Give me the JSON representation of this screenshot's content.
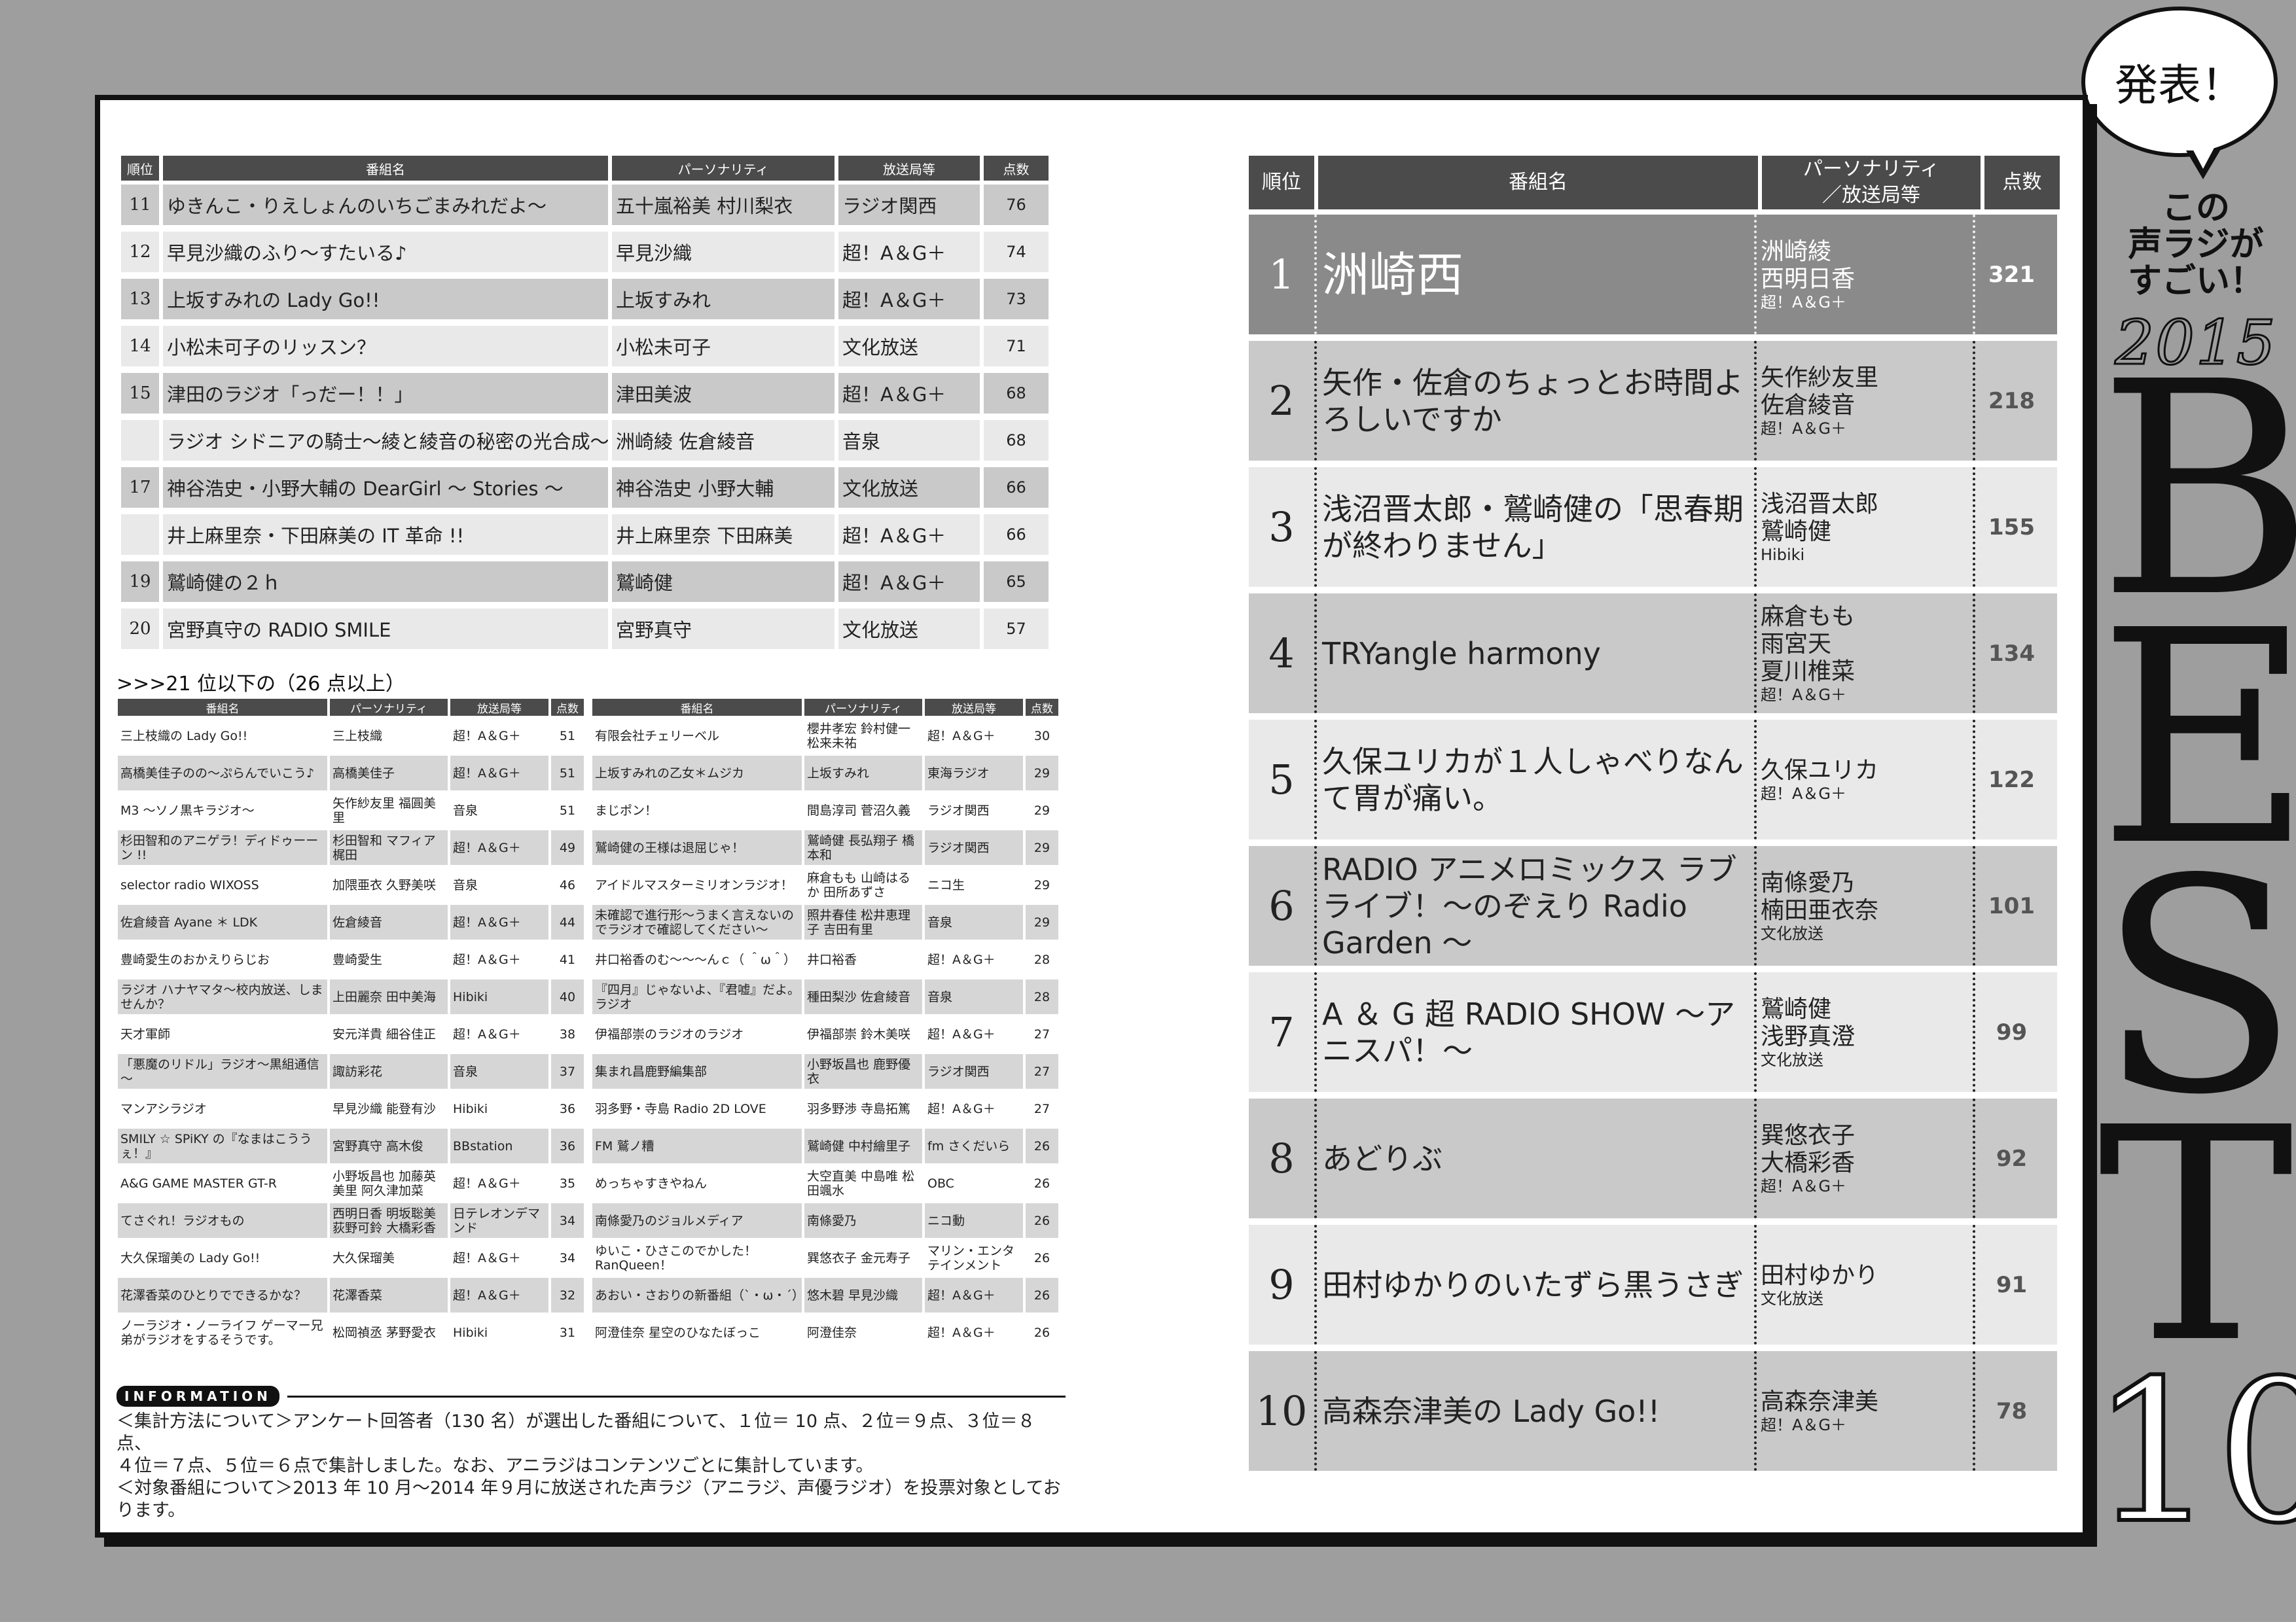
{
  "badge": {
    "text": "発表！"
  },
  "side": {
    "title_lines": [
      "この",
      "声ラジが",
      "すごい！"
    ],
    "year": "2015",
    "word_letters": [
      "B",
      "E",
      "S",
      "T"
    ],
    "number": "10"
  },
  "table_11_20": {
    "headers": {
      "rank": "順位",
      "name": "番組名",
      "personality": "パーソナリティ",
      "station": "放送局等",
      "points": "点数"
    },
    "rows": [
      {
        "rank": "11",
        "name": "ゆきんこ・りえしょんのいちごまみれだよ～",
        "personality": "五十嵐裕美 村川梨衣",
        "station": "ラジオ関西",
        "points": "76"
      },
      {
        "rank": "12",
        "name": "早見沙織のふり～すたいる♪",
        "personality": "早見沙織",
        "station": "超！A＆G＋",
        "points": "74"
      },
      {
        "rank": "13",
        "name": "上坂すみれの Lady Go!!",
        "personality": "上坂すみれ",
        "station": "超！A＆G＋",
        "points": "73"
      },
      {
        "rank": "14",
        "name": "小松未可子のリッスン？",
        "personality": "小松未可子",
        "station": "文化放送",
        "points": "71"
      },
      {
        "rank": "15",
        "name": "津田のラジオ「っだー！！」",
        "personality": "津田美波",
        "station": "超！A＆G＋",
        "points": "68"
      },
      {
        "rank": "",
        "name": "ラジオ シドニアの騎士～綾と綾音の秘密の光合成～",
        "personality": "洲崎綾 佐倉綾音",
        "station": "音泉",
        "points": "68"
      },
      {
        "rank": "17",
        "name": "神谷浩史・小野大輔の DearGirl ～ Stories ～",
        "personality": "神谷浩史 小野大輔",
        "station": "文化放送",
        "points": "66"
      },
      {
        "rank": "",
        "name": "井上麻里奈・下田麻美の IT 革命 !!",
        "personality": "井上麻里奈 下田麻美",
        "station": "超！A＆G＋",
        "points": "66"
      },
      {
        "rank": "19",
        "name": "鷲崎健の２ｈ",
        "personality": "鷲崎健",
        "station": "超！A＆G＋",
        "points": "65"
      },
      {
        "rank": "20",
        "name": "宮野真守の RADIO SMILE",
        "personality": "宮野真守",
        "station": "文化放送",
        "points": "57"
      }
    ]
  },
  "sub_heading": ">>>21 位以下の（26 点以上）",
  "small_headers": {
    "name": "番組名",
    "personality": "パーソナリティ",
    "station": "放送局等",
    "points": "点数"
  },
  "small_left": [
    {
      "name": "三上枝織の Lady Go!!",
      "personality": "三上枝織",
      "station": "超！A＆G＋",
      "points": "51"
    },
    {
      "name": "高橋美佳子のの～ぷらんでいこう♪",
      "personality": "高橋美佳子",
      "station": "超！A＆G＋",
      "points": "51"
    },
    {
      "name": "M3 ～ソノ黒キラジオ～",
      "personality": "矢作紗友里 福圓美里",
      "station": "音泉",
      "points": "51"
    },
    {
      "name": "杉田智和のアニゲラ！ディドゥーーン !!",
      "personality": "杉田智和 マフィア梶田",
      "station": "超！A＆G＋",
      "points": "49"
    },
    {
      "name": "selector radio WIXOSS",
      "personality": "加隈亜衣 久野美咲",
      "station": "音泉",
      "points": "46"
    },
    {
      "name": "佐倉綾音 Ayane ＊ LDK",
      "personality": "佐倉綾音",
      "station": "超！A＆G＋",
      "points": "44"
    },
    {
      "name": "豊崎愛生のおかえりらじお",
      "personality": "豊崎愛生",
      "station": "超！A＆G＋",
      "points": "41"
    },
    {
      "name": "ラジオ ハナヤマタ～校内放送、しませんか？",
      "personality": "上田麗奈 田中美海",
      "station": "Hibiki",
      "points": "40"
    },
    {
      "name": "天才軍師",
      "personality": "安元洋貴 細谷佳正",
      "station": "超！A＆G＋",
      "points": "38"
    },
    {
      "name": "「悪魔のリドル」ラジオ～黒組通信～",
      "personality": "諏訪彩花",
      "station": "音泉",
      "points": "37"
    },
    {
      "name": "マンアシラジオ",
      "personality": "早見沙織 能登有沙",
      "station": "Hibiki",
      "points": "36"
    },
    {
      "name": "SMILY ☆ SPiKY の『なまはこううぇ！』",
      "personality": "宮野真守 高木俊",
      "station": "BBstation",
      "points": "36"
    },
    {
      "name": "A&G GAME MASTER GT-R",
      "personality": "小野坂昌也 加藤英美里 阿久津加菜",
      "station": "超！A＆G＋",
      "points": "35"
    },
    {
      "name": "てさぐれ！ラジオもの",
      "personality": "西明日香 明坂聡美 荻野可鈴 大橋彩香",
      "station": "日テレオンデマンド",
      "points": "34"
    },
    {
      "name": "大久保瑠美の Lady Go!!",
      "personality": "大久保瑠美",
      "station": "超！A＆G＋",
      "points": "34"
    },
    {
      "name": "花澤香菜のひとりでできるかな？",
      "personality": "花澤香菜",
      "station": "超！A＆G＋",
      "points": "32"
    },
    {
      "name": "ノーラジオ・ノーライフ ゲーマー兄弟がラジオをするそうです。",
      "personality": "松岡禎丞 茅野愛衣",
      "station": "Hibiki",
      "points": "31"
    }
  ],
  "small_right": [
    {
      "name": "有限会社チェリーベル",
      "personality": "櫻井孝宏 鈴村健一 松来未祐",
      "station": "超！A＆G＋",
      "points": "30"
    },
    {
      "name": "上坂すみれの乙女＊ムジカ",
      "personality": "上坂すみれ",
      "station": "東海ラジオ",
      "points": "29"
    },
    {
      "name": "まじポン！",
      "personality": "間島淳司 菅沼久義",
      "station": "ラジオ関西",
      "points": "29"
    },
    {
      "name": "鷲崎健の王様は退屈じゃ！",
      "personality": "鷲崎健 長弘翔子 橋本和",
      "station": "ラジオ関西",
      "points": "29"
    },
    {
      "name": "アイドルマスターミリオンラジオ！",
      "personality": "麻倉もも 山崎はるか 田所あずさ",
      "station": "ニコ生",
      "points": "29"
    },
    {
      "name": "未確認で進行形～うまく言えないのでラジオで確認してください～",
      "personality": "照井春佳 松井恵理子 吉田有里",
      "station": "音泉",
      "points": "29"
    },
    {
      "name": "井口裕香のむ～～～んｃ（ ＾ω＾）",
      "personality": "井口裕香",
      "station": "超！A＆G＋",
      "points": "28"
    },
    {
      "name": "『四月』じゃないよ、『君嘘』だよ。ラジオ",
      "personality": "種田梨沙 佐倉綾音",
      "station": "音泉",
      "points": "28"
    },
    {
      "name": "伊福部崇のラジオのラジオ",
      "personality": "伊福部崇 鈴木美咲",
      "station": "超！A＆G＋",
      "points": "27"
    },
    {
      "name": "集まれ昌鹿野編集部",
      "personality": "小野坂昌也 鹿野優衣",
      "station": "ラジオ関西",
      "points": "27"
    },
    {
      "name": "羽多野・寺島 Radio 2D LOVE",
      "personality": "羽多野渉 寺島拓篤",
      "station": "超！A＆G＋",
      "points": "27"
    },
    {
      "name": "FM 鷲ノ糟",
      "personality": "鷲崎健 中村繪里子",
      "station": "fm さくだいら",
      "points": "26"
    },
    {
      "name": "めっちゃすきやねん",
      "personality": "大空直美 中島唯 松田颯水",
      "station": "OBC",
      "points": "26"
    },
    {
      "name": "南條愛乃のジョルメディア",
      "personality": "南條愛乃",
      "station": "ニコ動",
      "points": "26"
    },
    {
      "name": "ゆいこ・ひさこのでかした！RanQueen！",
      "personality": "巽悠衣子 金元寿子",
      "station": "マリン・エンタテインメント",
      "points": "26"
    },
    {
      "name": "あおい・さおりの新番組（`・ω・´）",
      "personality": "悠木碧 早見沙織",
      "station": "超！A＆G＋",
      "points": "26"
    },
    {
      "name": "阿澄佳奈 星空のひなたぼっこ",
      "personality": "阿澄佳奈",
      "station": "超！A＆G＋",
      "points": "26"
    }
  ],
  "information": {
    "badge": "INFORMATION",
    "lines": [
      "＜集計方法について＞アンケート回答者（130 名）が選出した番組について、１位＝ 10 点、２位＝９点、３位＝８点、",
      "４位＝７点、５位＝６点で集計しました。なお、アニラジはコンテンツごとに集計しています。",
      "＜対象番組について＞2013 年 10 月～2014 年９月に放送された声ラジ（アニラジ、声優ラジオ）を投票対象としております。"
    ]
  },
  "best10": {
    "headers": {
      "rank": "順位",
      "name": "番組名",
      "personality_line1": "パーソナリティ",
      "personality_line2": "／放送局等",
      "points": "点数"
    },
    "rows": [
      {
        "rank": "1",
        "name": "洲崎西",
        "personalities": [
          "洲崎綾",
          "西明日香"
        ],
        "station": "超！A＆G＋",
        "points": "321"
      },
      {
        "rank": "2",
        "name": "矢作・佐倉のちょっとお時間よろしいですか",
        "personalities": [
          "矢作紗友里",
          "佐倉綾音"
        ],
        "station": "超！A＆G＋",
        "points": "218"
      },
      {
        "rank": "3",
        "name": "浅沼晋太郎・鷲崎健の「思春期が終わりません」",
        "personalities": [
          "浅沼晋太郎",
          "鷲崎健"
        ],
        "station": "Hibiki",
        "points": "155"
      },
      {
        "rank": "4",
        "name": "TRYangle harmony",
        "personalities": [
          "麻倉もも",
          "雨宮天",
          "夏川椎菜"
        ],
        "station": "超！A＆G＋",
        "points": "134"
      },
      {
        "rank": "5",
        "name": "久保ユリカが１人しゃべりなんて胃が痛い。",
        "personalities": [
          "久保ユリカ"
        ],
        "station": "超！A＆G＋",
        "points": "122"
      },
      {
        "rank": "6",
        "name": "RADIO アニメロミックス ラブライブ！～のぞえり Radio Garden ～",
        "personalities": [
          "南條愛乃",
          "楠田亜衣奈"
        ],
        "station": "文化放送",
        "points": "101"
      },
      {
        "rank": "7",
        "name": "A ＆ G 超 RADIO SHOW ～アニスパ！～",
        "personalities": [
          "鷲崎健",
          "浅野真澄"
        ],
        "station": "文化放送",
        "points": "99"
      },
      {
        "rank": "8",
        "name": "あどりぶ",
        "personalities": [
          "巽悠衣子",
          "大橋彩香"
        ],
        "station": "超！A＆G＋",
        "points": "92"
      },
      {
        "rank": "9",
        "name": "田村ゆかりのいたずら黒うさぎ",
        "personalities": [
          "田村ゆかり"
        ],
        "station": "文化放送",
        "points": "91"
      },
      {
        "rank": "10",
        "name": "高森奈津美の Lady Go!!",
        "personalities": [
          "高森奈津美"
        ],
        "station": "超！A＆G＋",
        "points": "78"
      }
    ]
  }
}
